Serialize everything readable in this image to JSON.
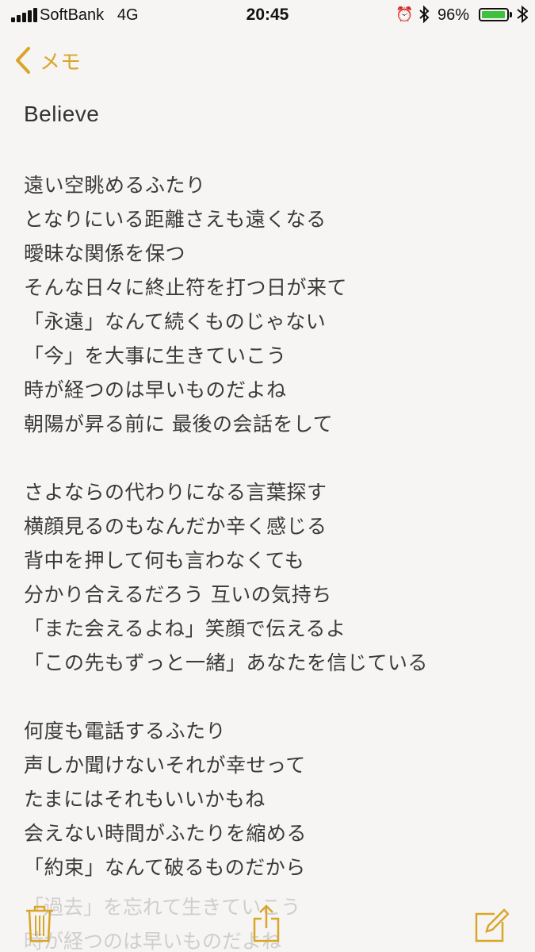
{
  "status_bar": {
    "carrier": "SoftBank",
    "network": "4G",
    "time": "20:45",
    "battery_percent": "96%",
    "battery_level": 0.96,
    "battery_color": "#3ec23e",
    "icons": [
      "signal-icon",
      "alarm-icon",
      "bluetooth-icon",
      "battery-icon",
      "charging-icon"
    ]
  },
  "nav": {
    "back_label": "メモ",
    "accent_color": "#d9a62a"
  },
  "note": {
    "title": "Believe",
    "lines": [
      "遠い空眺めるふたり",
      "となりにいる距離さえも遠くなる",
      "曖昧な関係を保つ",
      "そんな日々に終止符を打つ日が来て",
      "「永遠」なんて続くものじゃない",
      "「今」を大事に生きていこう",
      "時が経つのは早いものだよね",
      "朝陽が昇る前に 最後の会話をして",
      "",
      "さよならの代わりになる言葉探す",
      "横顔見るのもなんだか辛く感じる",
      "背中を押して何も言わなくても",
      "分かり合えるだろう 互いの気持ち",
      "「また会えるよね」笑顔で伝えるよ",
      "「この先もずっと一緒」あなたを信じている",
      "",
      "何度も電話するふたり",
      "声しか聞けないそれが幸せって",
      "たまにはそれもいいかもね",
      "会えない時間がふたりを縮める",
      "「約束」なんて破るものだから"
    ],
    "faded_lines": [
      "「過去」を忘れて生きていこう",
      "時が経つのは早いものだよね"
    ]
  },
  "toolbar": {
    "icons": [
      "trash-icon",
      "share-icon",
      "compose-icon"
    ]
  }
}
